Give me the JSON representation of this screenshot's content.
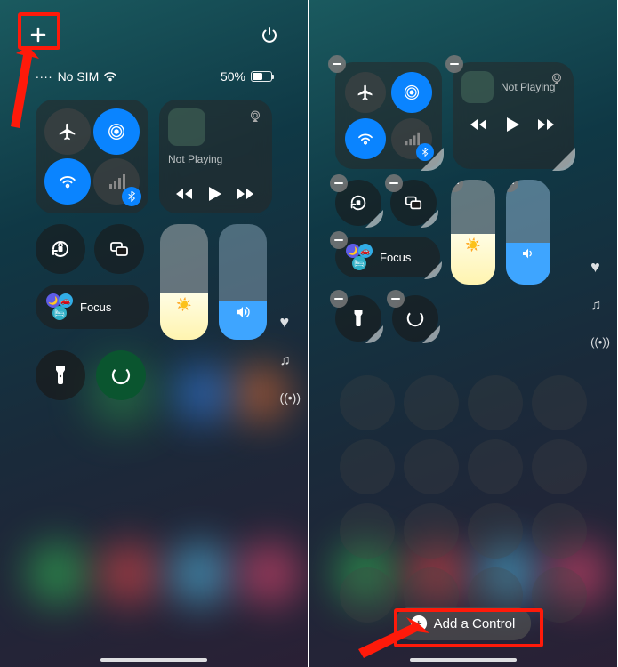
{
  "left": {
    "status": {
      "carrier": "No SIM",
      "battery_pct": "50%"
    },
    "connectivity": {
      "airplane": {
        "on": false
      },
      "airdrop": {
        "on": true
      },
      "wifi": {
        "on": true
      },
      "cellular": {
        "on": false
      },
      "bluetooth": {
        "on": true
      }
    },
    "now_playing": {
      "label": "Not Playing"
    },
    "focus": {
      "label": "Focus"
    },
    "brightness_pct": 40,
    "volume_pct": 34
  },
  "right": {
    "connectivity": {
      "airplane": {
        "on": false
      },
      "airdrop": {
        "on": true
      },
      "wifi": {
        "on": true
      },
      "cellular": {
        "on": false
      },
      "bluetooth": {
        "on": true
      }
    },
    "now_playing": {
      "label": "Not Playing"
    },
    "focus": {
      "label": "Focus"
    },
    "brightness_pct": 48,
    "volume_pct": 40,
    "add_control_label": "Add a Control"
  },
  "colors": {
    "accent_blue": "#0a84ff",
    "highlight_red": "#ff1a0a"
  }
}
